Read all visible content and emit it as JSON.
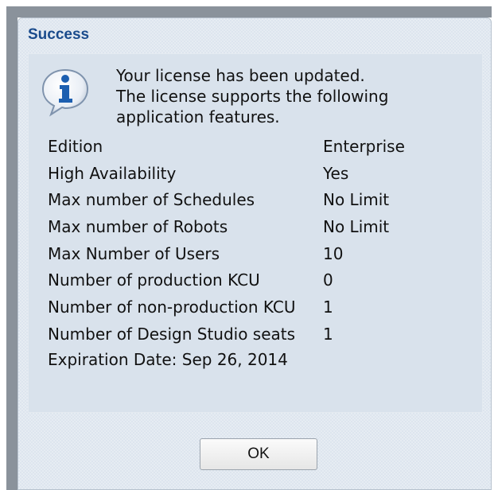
{
  "dialog": {
    "title": "Success",
    "icon": "info-icon",
    "message_lines": [
      "Your license has been updated.",
      "The license supports the following",
      "application features."
    ],
    "features": [
      {
        "label": "Edition",
        "value": "Enterprise"
      },
      {
        "label": "High Availability",
        "value": "Yes"
      },
      {
        "label": "Max number of Schedules",
        "value": "No Limit"
      },
      {
        "label": "Max number of Robots",
        "value": "No Limit"
      },
      {
        "label": "Max Number of Users",
        "value": "10"
      },
      {
        "label": "Number of production KCU",
        "value": "0"
      },
      {
        "label": "Number of non-production KCU",
        "value": "1"
      },
      {
        "label": "Number of Design Studio seats",
        "value": "1"
      }
    ],
    "expiration": "Expiration Date: Sep 26, 2014",
    "ok_label": "OK"
  },
  "colors": {
    "title": "#1a4b8c",
    "dialog_background": "#dde5ee",
    "backdrop": "#8a929b",
    "icon_blue": "#1d5fb0"
  }
}
